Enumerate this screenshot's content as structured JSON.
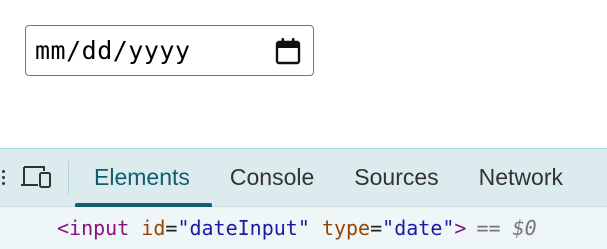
{
  "date_input": {
    "placeholder_text": "mm/dd/yyyy",
    "icon": "calendar-icon"
  },
  "devtools": {
    "toolbar": {
      "device_toggle_icon": "device-toolbar-icon"
    },
    "tabs": [
      {
        "label": "Elements",
        "active": true
      },
      {
        "label": "Console",
        "active": false
      },
      {
        "label": "Sources",
        "active": false
      },
      {
        "label": "Network",
        "active": false
      }
    ],
    "selected_node": {
      "tag_open": "<input",
      "attr1_name": "id",
      "attr1_value": "\"dateInput\"",
      "attr2_name": "type",
      "attr2_value": "\"date\"",
      "tag_close": ">",
      "selection_ref": "== $0"
    },
    "colors": {
      "active_tab": "#0f5d6e",
      "tabbar_bg": "#dcecee",
      "tag": "#881280",
      "attr_name": "#994500",
      "attr_value": "#1a1aa6"
    }
  }
}
